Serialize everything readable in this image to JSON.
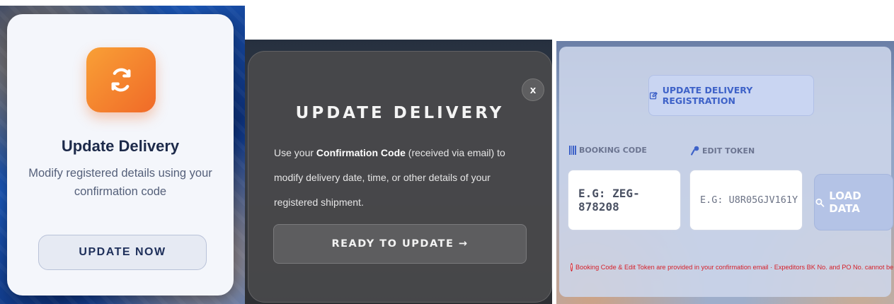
{
  "panel1": {
    "icon": "refresh-icon",
    "title": "Update Delivery",
    "subtitle": "Modify registered details using your confirmation code",
    "button_label": "UPDATE NOW",
    "accent": "#f07a2c"
  },
  "panel2": {
    "close_label": "x",
    "title": "UPDATE DELIVERY",
    "body_prefix": "Use your ",
    "body_bold": "Confirmation Code",
    "body_suffix": " (received via email) to modify delivery date, time, or other details of your registered shipment.",
    "button_label": "READY TO UPDATE →"
  },
  "panel3": {
    "header_icon": "edit-icon",
    "header_label": "UPDATE DELIVERY REGISTRATION",
    "booking_label": "BOOKING CODE",
    "booking_icon": "barcode-icon",
    "booking_placeholder": "E.G: ZEG-878208",
    "token_label": "EDIT TOKEN",
    "token_icon": "key-icon",
    "token_placeholder": "E.G: U8R05GJV161Y",
    "load_label": "LOAD DATA",
    "load_icon": "search-icon",
    "note": "Booking Code & Edit Token are provided in your confirmation email · Expeditors BK No. and PO No. cannot be modified",
    "accent": "#3e62c8",
    "warning_color": "#d6202a"
  }
}
